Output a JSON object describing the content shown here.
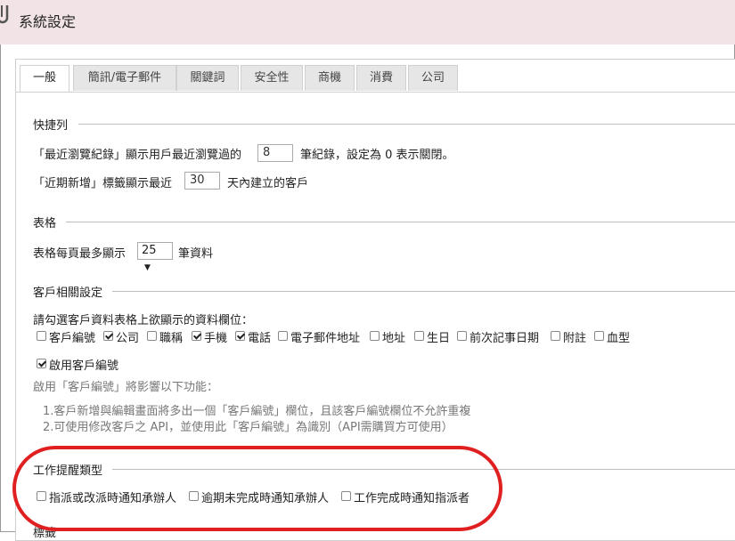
{
  "header": {
    "title": "系統設定"
  },
  "tabs": [
    {
      "label": "一般"
    },
    {
      "label": "簡訊/電子郵件"
    },
    {
      "label": "關鍵詞"
    },
    {
      "label": "安全性"
    },
    {
      "label": "商機"
    },
    {
      "label": "消費"
    },
    {
      "label": "公司"
    }
  ],
  "quickbar": {
    "legend": "快捷列",
    "recent_pre": "「最近瀏覽紀錄」顯示用戶最近瀏覽過的",
    "recent_value": "8",
    "recent_post": "筆紀錄，設定為 0 表示關閉。",
    "new_pre": "「近期新增」標籤顯示最近",
    "new_value": "30",
    "new_post": "天內建立的客戶"
  },
  "table": {
    "legend": "表格",
    "rows_pre": "表格每頁最多顯示",
    "rows_value": "25",
    "rows_post": "筆資料"
  },
  "customer": {
    "legend": "客戶相關設定",
    "prompt": "請勾選客戶資料表格上欲顯示的資料欄位：",
    "fields": [
      {
        "label": "客戶編號",
        "checked": false
      },
      {
        "label": "公司",
        "checked": true
      },
      {
        "label": "職稱",
        "checked": false
      },
      {
        "label": "手機",
        "checked": true
      },
      {
        "label": "電話",
        "checked": true
      },
      {
        "label": "電子郵件地址",
        "checked": false
      },
      {
        "label": "地址",
        "checked": false
      },
      {
        "label": "生日",
        "checked": false
      },
      {
        "label": "前次記事日期",
        "checked": false
      },
      {
        "label": "附註",
        "checked": false
      },
      {
        "label": "血型",
        "checked": false
      }
    ],
    "enable_id_label": "啟用客戶編號",
    "enable_id_checked": true,
    "note_title": "啟用「客戶編號」將影響以下功能：",
    "note_1": "1.客戶新增與編輯畫面將多出一個「客戶編號」欄位，且該客戶編號欄位不允許重複",
    "note_2": "2.可使用修改客戶之 API，並使用此「客戶編號」為識別（API需購買方可使用）"
  },
  "reminder": {
    "legend": "工作提醒類型",
    "options": [
      {
        "label": "指派或改派時通知承辦人",
        "checked": false
      },
      {
        "label": "逾期未完成時通知承辦人",
        "checked": false
      },
      {
        "label": "工作完成時通知指派者",
        "checked": false
      }
    ]
  },
  "next_section": {
    "legend": "標籤"
  }
}
